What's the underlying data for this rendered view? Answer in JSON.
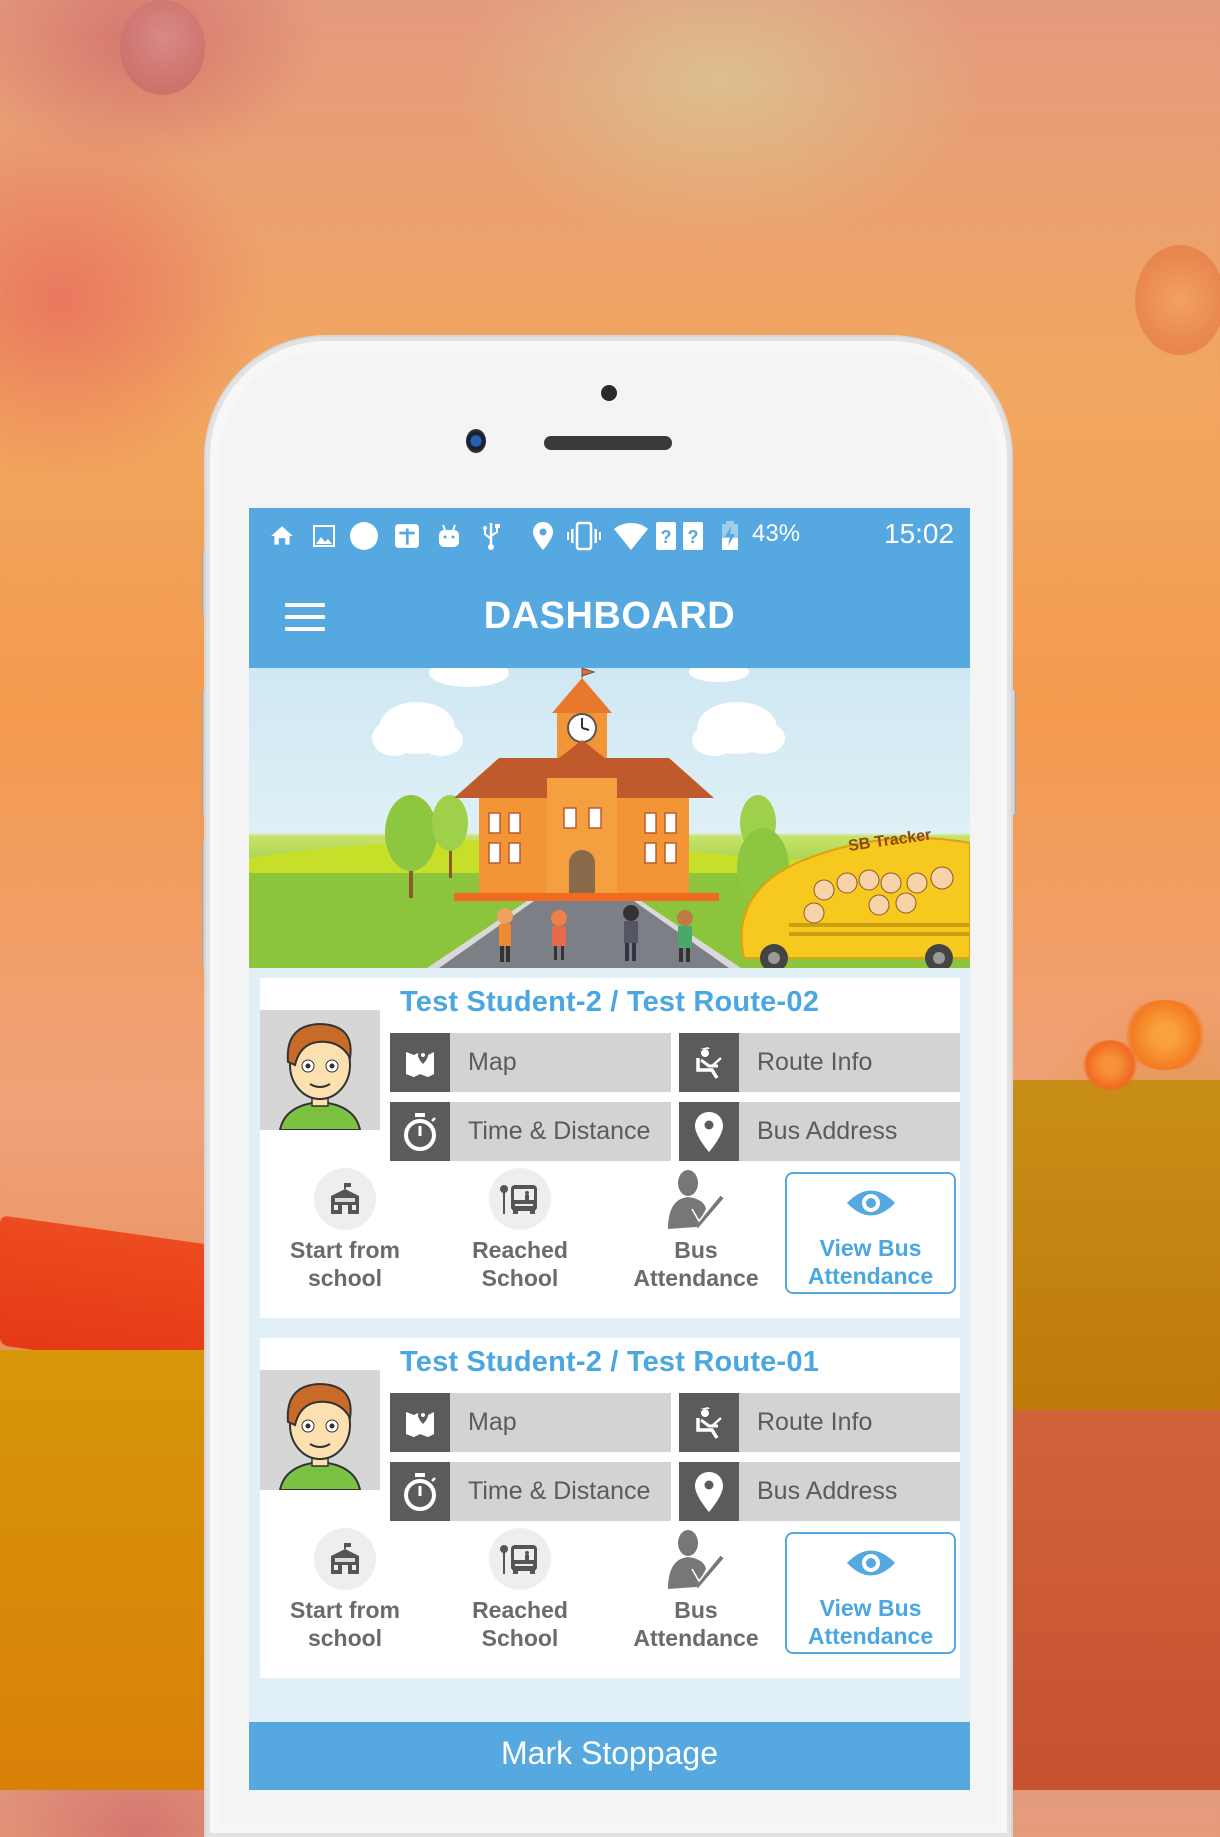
{
  "status_bar": {
    "icons": [
      "home-icon",
      "image-icon",
      "circle-icon",
      "calendar-plus-icon",
      "android-icon",
      "usb-icon",
      "location-icon",
      "vibrate-icon",
      "wifi-icon",
      "sim1-unknown-icon",
      "sim2-unknown-icon",
      "battery-charging-icon"
    ],
    "battery": "43%",
    "time": "15:02"
  },
  "header": {
    "title": "DASHBOARD",
    "menu_icon": "hamburger-menu-icon"
  },
  "banner": {
    "bus_label": "SB Tracker"
  },
  "cards": [
    {
      "title": "Test Student-2 / Test Route-02",
      "grid_buttons": [
        {
          "label": "Map",
          "icon": "map-icon"
        },
        {
          "label": "Route Info",
          "icon": "driver-seat-icon"
        },
        {
          "label": "Time & Distance",
          "icon": "stopwatch-icon"
        },
        {
          "label": "Bus Address",
          "icon": "location-pin-icon"
        }
      ],
      "actions": [
        {
          "label_line1": "Start from",
          "label_line2": "school",
          "icon": "school-building-icon"
        },
        {
          "label_line1": "Reached",
          "label_line2": "School",
          "icon": "bus-stop-icon"
        },
        {
          "label_line1": "Bus",
          "label_line2": "Attendance",
          "icon": "person-check-icon"
        },
        {
          "label_line1": "View Bus",
          "label_line2": "Attendance",
          "icon": "eye-icon"
        }
      ]
    },
    {
      "title": "Test Student-2 / Test Route-01",
      "grid_buttons": [
        {
          "label": "Map",
          "icon": "map-icon"
        },
        {
          "label": "Route Info",
          "icon": "driver-seat-icon"
        },
        {
          "label": "Time & Distance",
          "icon": "stopwatch-icon"
        },
        {
          "label": "Bus Address",
          "icon": "location-pin-icon"
        }
      ],
      "actions": [
        {
          "label_line1": "Start from",
          "label_line2": "school",
          "icon": "school-building-icon"
        },
        {
          "label_line1": "Reached",
          "label_line2": "School",
          "icon": "bus-stop-icon"
        },
        {
          "label_line1": "Bus",
          "label_line2": "Attendance",
          "icon": "person-check-icon"
        },
        {
          "label_line1": "View Bus",
          "label_line2": "Attendance",
          "icon": "eye-icon"
        }
      ]
    }
  ],
  "footer": {
    "mark_stoppage_label": "Mark Stoppage"
  },
  "colors": {
    "primary": "#55a8e0",
    "title_text": "#4ba7df",
    "grid_button_bg": "#d3d3d3",
    "grid_icon_bg": "#5c5a5a"
  }
}
